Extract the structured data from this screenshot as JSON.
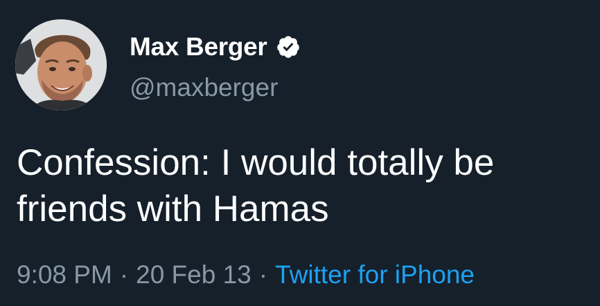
{
  "tweet": {
    "author": {
      "display_name": "Max Berger",
      "handle": "@maxberger",
      "verified_icon": "verified-badge-icon",
      "avatar": "profile-photo"
    },
    "text": "Confession: I would totally be\nfriends with Hamas",
    "meta": {
      "time": "9:08 PM",
      "separator": "·",
      "date": "20 Feb 13",
      "source": "Twitter for iPhone"
    }
  },
  "colors": {
    "background": "#15202b",
    "primary_text": "#ffffff",
    "secondary_text": "#8899a6",
    "link": "#1da1f2"
  }
}
